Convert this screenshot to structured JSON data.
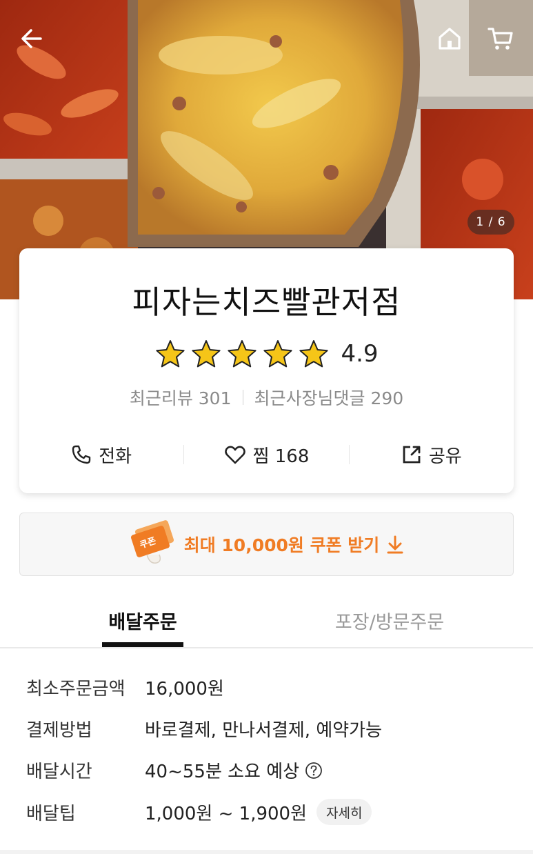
{
  "hero": {
    "photo_counter": "1 / 6",
    "icons": [
      "back-arrow-icon",
      "home-icon",
      "cart-icon"
    ]
  },
  "store": {
    "name": "피자는치즈빨관저점",
    "rating": "4.9",
    "rating_value": 4.9,
    "rating_max": 5,
    "recent_reviews_label": "최근리뷰 301",
    "recent_owner_replies_label": "최근사장님댓글 290",
    "actions": {
      "call_label": "전화",
      "like_label": "찜 168",
      "share_label": "공유"
    }
  },
  "coupon": {
    "badge_text": "쿠폰",
    "label": "최대 10,000원 쿠폰 받기"
  },
  "tabs": [
    {
      "label": "배달주문",
      "active": true
    },
    {
      "label": "포장/방문주문",
      "active": false
    }
  ],
  "info": [
    {
      "label": "최소주문금액",
      "value": "16,000원"
    },
    {
      "label": "결제방법",
      "value": "바로결제, 만나서결제, 예약가능"
    },
    {
      "label": "배달시간",
      "value": "40~55분 소요 예상"
    },
    {
      "label": "배달팁",
      "value": "1,000원 ~ 1,900원",
      "button": "자세히"
    }
  ],
  "colors": {
    "accent_orange": "#f07c24",
    "star_yellow": "#f5c518",
    "text_gray": "#8a8a8a"
  }
}
